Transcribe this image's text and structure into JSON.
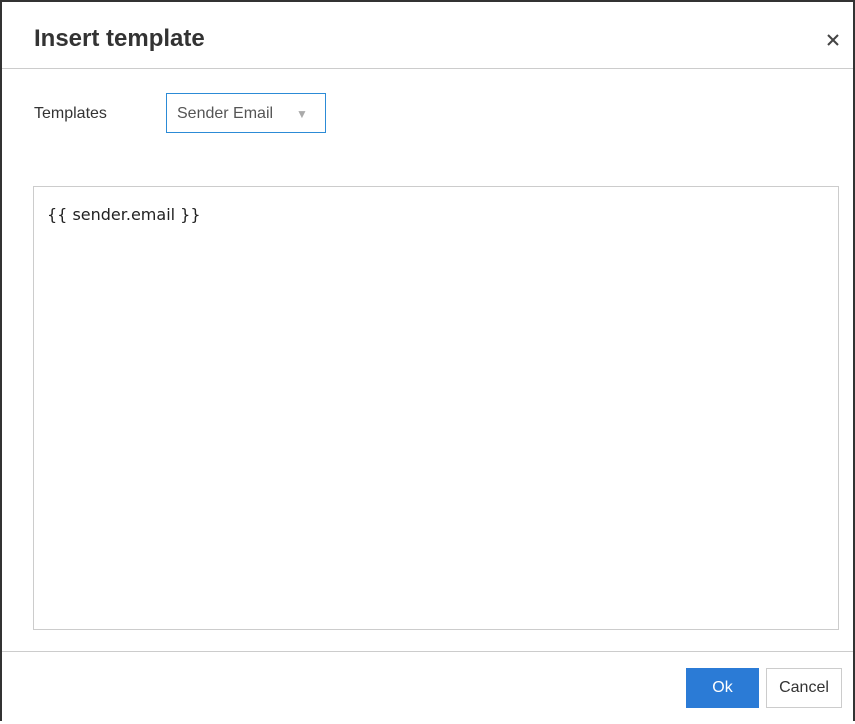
{
  "dialog": {
    "title": "Insert template",
    "close_icon": "close-icon"
  },
  "form": {
    "templates_label": "Templates",
    "selected_template": "Sender Email",
    "dropdown_icon": "caret-down-icon"
  },
  "preview": {
    "content": "{{ sender.email }}"
  },
  "footer": {
    "ok_label": "Ok",
    "cancel_label": "Cancel"
  },
  "colors": {
    "accent": "#2b7bd6",
    "select_border": "#2c8bd6",
    "divider": "#cccccc"
  }
}
